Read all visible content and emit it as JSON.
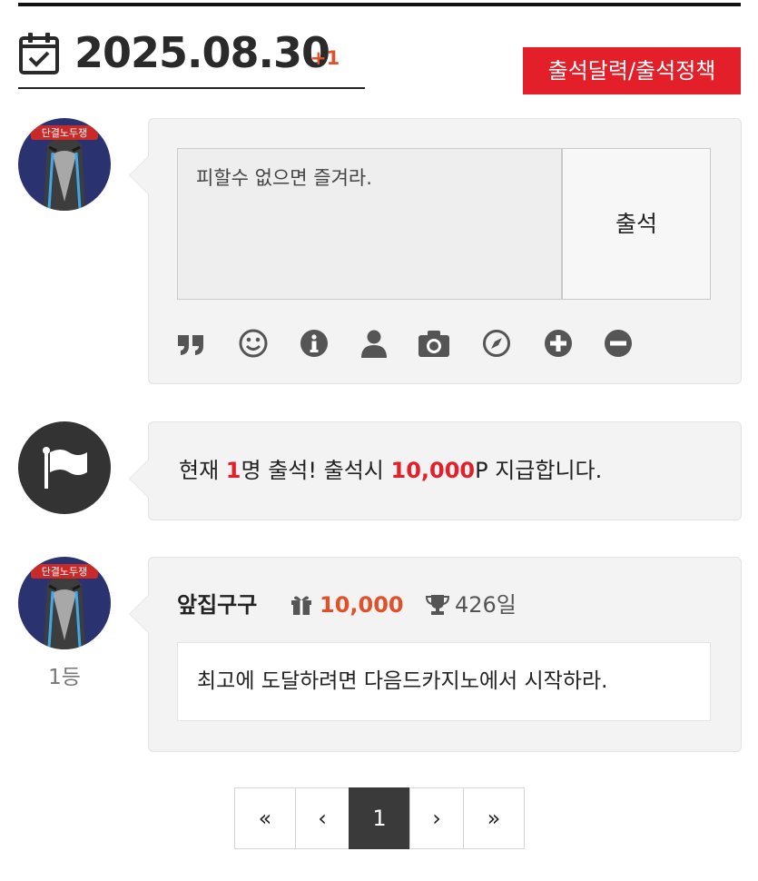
{
  "header": {
    "date": "2025.08.30",
    "plus": "+1",
    "policy_label": "출석달력/출석정책"
  },
  "form": {
    "greeting": "피할수 없으면 즐겨라.",
    "submit_label": "출석",
    "toolbar": [
      "quote-icon",
      "smile-icon",
      "info-icon",
      "user-icon",
      "camera-icon",
      "compass-icon",
      "plus-circle-icon",
      "minus-circle-icon"
    ]
  },
  "notice": {
    "prefix": "현재 ",
    "count": "1",
    "middle": "명 출석! 출석시 ",
    "points": "10,000",
    "suffix": "P 지급합니다."
  },
  "entries": [
    {
      "name": "앞집구구",
      "points": "10,000",
      "days": "426일",
      "comment": "최고에 도달하려면 다음드카지노에서 시작하라.",
      "rank": "1등"
    }
  ],
  "avatar_text": "단결노두쟁",
  "pagination": {
    "first": "«",
    "prev": "‹",
    "current": "1",
    "next": "›",
    "last": "»"
  },
  "colors": {
    "accent_red": "#e3202a",
    "accent_orange": "#e0502a",
    "panel_bg": "#f3f3f3"
  }
}
